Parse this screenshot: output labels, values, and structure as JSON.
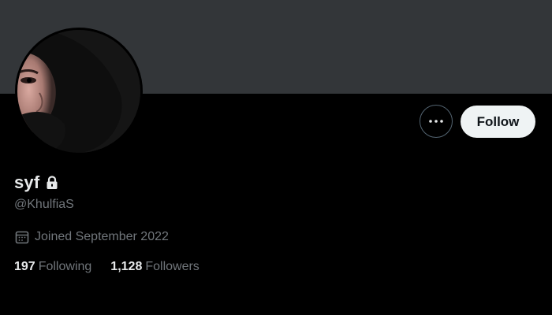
{
  "profile": {
    "display_name": "syf",
    "handle": "@KhulfiaS",
    "joined": "Joined September 2022",
    "protected_icon": "lock-icon",
    "avatar_icon": "profile-photo"
  },
  "actions": {
    "more_icon": "ellipsis-icon",
    "follow_label": "Follow"
  },
  "stats": {
    "following_count": "197",
    "following_label": "Following",
    "followers_count": "1,128",
    "followers_label": "Followers"
  },
  "colors": {
    "background": "#000000",
    "banner": "#333639",
    "primary_text": "#e7e9ea",
    "secondary_text": "#71767b",
    "follow_button_bg": "#eff3f4",
    "follow_button_text": "#0f1419",
    "outline": "#536471"
  }
}
